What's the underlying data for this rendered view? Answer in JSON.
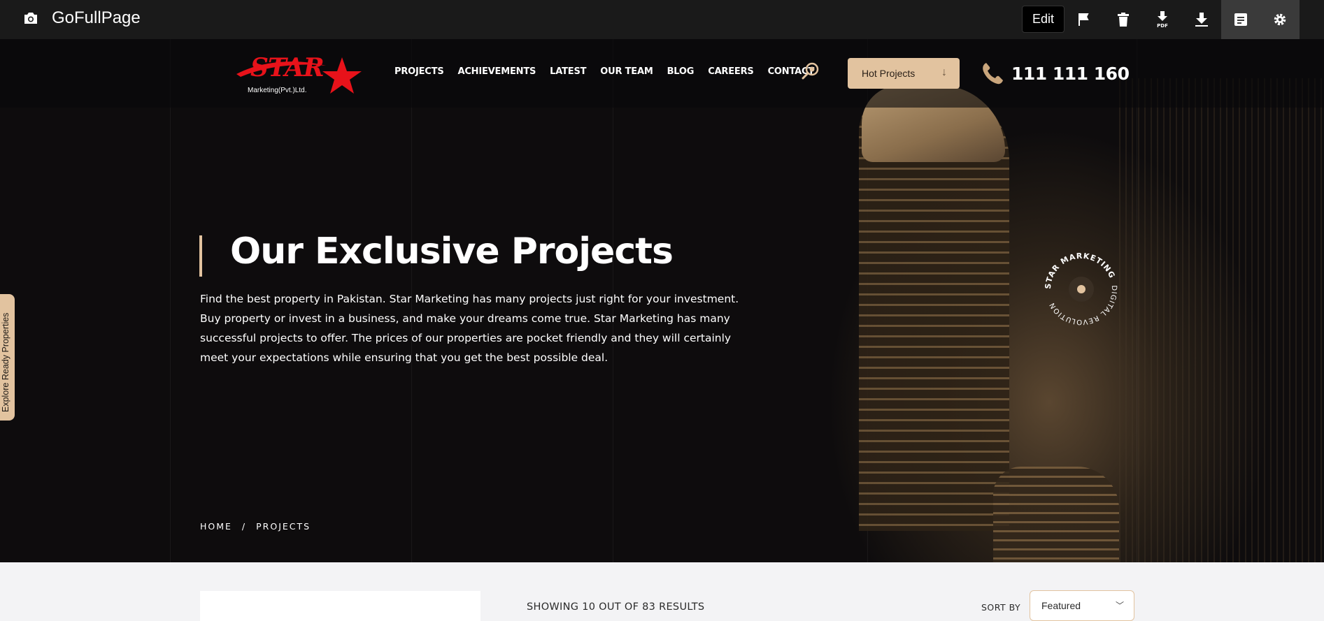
{
  "toolbar": {
    "app_title": "GoFullPage",
    "edit_label": "Edit",
    "icons": [
      "camera-icon",
      "flag-icon",
      "trash-icon",
      "pdf-download-icon",
      "download-icon",
      "document-icon",
      "gear-icon"
    ]
  },
  "header": {
    "logo_text": "STAR",
    "logo_subtext": "Marketing(Pvt.)Ltd.",
    "nav": [
      {
        "label": "PROJECTS"
      },
      {
        "label": "ACHIEVEMENTS"
      },
      {
        "label": "LATEST"
      },
      {
        "label": "OUR TEAM"
      },
      {
        "label": "BLOG"
      },
      {
        "label": "CAREERS"
      },
      {
        "label": "CONTACT"
      }
    ],
    "hot_projects_label": "Hot Projects",
    "phone": "111 111 160"
  },
  "hero": {
    "title": "Our Exclusive Projects",
    "description": "Find the best property in Pakistan. Star Marketing has many projects just right for your investment. Buy property or invest in a business, and make your dreams come true. Star Marketing has many successful projects to offer. The prices of our properties are pocket friendly and they will certainly meet your expectations while ensuring that you get the best possible deal.",
    "breadcrumb": {
      "home": "HOME",
      "separator": "/",
      "current": "PROJECTS"
    },
    "badge_text_1": "STAR MARKETING",
    "badge_text_2": "DIGITAL REVOLUTION"
  },
  "side_tab": {
    "label": "Explore Ready Properties"
  },
  "listing": {
    "results_text": "SHOWING 10 OUT OF 83 RESULTS",
    "sort_label": "SORT BY",
    "sort_value": "Featured"
  },
  "colors": {
    "accent": "#e2c39f",
    "logo_red": "#e8121a",
    "toolbar_bg": "#1a1a1a"
  }
}
